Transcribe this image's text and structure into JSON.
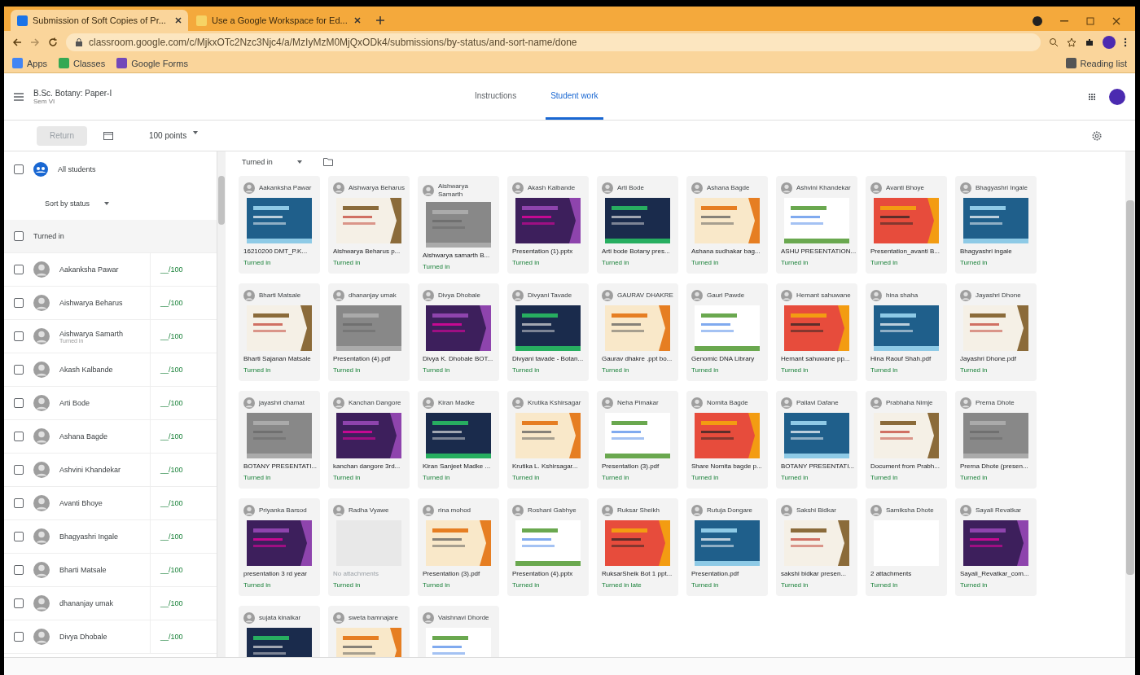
{
  "browser": {
    "tabs": [
      {
        "title": "Submission of Soft Copies of Pr...",
        "selected": true
      },
      {
        "title": "Use a Google Workspace for Ed...",
        "selected": false
      }
    ],
    "url": "classroom.google.com/c/MjkxOTc2Nzc3Njc4/a/MzIyMzM0MjQxODk4/submissions/by-status/and-sort-name/done",
    "bookmarks": [
      "Apps",
      "Classes",
      "Google Forms"
    ],
    "reading_list": "Reading list"
  },
  "header": {
    "class_name": "B.Sc. Botany: Paper-I",
    "section": "Sem VI",
    "tabs": [
      {
        "label": "Instructions",
        "selected": false
      },
      {
        "label": "Student work",
        "selected": true
      }
    ]
  },
  "toolbar": {
    "return_button": {
      "label": "Return",
      "disabled": true
    },
    "points": "100 points"
  },
  "sidebar": {
    "all_students": {
      "label": "All students",
      "checked": false
    },
    "sort": "Sort by status",
    "section": {
      "label": "Turned in",
      "checked": false
    },
    "students": [
      {
        "name": "Aakanksha Pawar",
        "grade": "__/100",
        "checked": false
      },
      {
        "name": "Aishwarya Beharus",
        "grade": "__/100",
        "checked": false
      },
      {
        "name": "Aishwarya Samarth",
        "note": "Turned in",
        "grade": "__/100",
        "checked": false
      },
      {
        "name": "Akash Kalbande",
        "grade": "__/100",
        "checked": false
      },
      {
        "name": "Arti Bode",
        "grade": "__/100",
        "checked": false
      },
      {
        "name": "Ashana Bagde",
        "grade": "__/100",
        "checked": false
      },
      {
        "name": "Ashvini Khandekar",
        "grade": "__/100",
        "checked": false
      },
      {
        "name": "Avanti Bhoye",
        "grade": "__/100",
        "checked": false
      },
      {
        "name": "Bhagyashri Ingale",
        "grade": "__/100",
        "checked": false
      },
      {
        "name": "Bharti Matsale",
        "grade": "__/100",
        "checked": false
      },
      {
        "name": "dhananjay umak",
        "grade": "__/100",
        "checked": false
      },
      {
        "name": "Divya Dhobale",
        "grade": "__/100",
        "checked": false
      }
    ]
  },
  "work": {
    "filter": "Turned in",
    "cards": [
      {
        "name": "Aakanksha Pawar",
        "file": "16210200 DMT_P.K...",
        "status": "Turned in",
        "kind": "picture"
      },
      {
        "name": "Aishwarya Beharus",
        "file": "Aishwarya Beharus p...",
        "status": "Turned in",
        "kind": "picture"
      },
      {
        "name": "Aishwarya Samarth",
        "file": "Aishwarya samarth B...",
        "status": "Turned in",
        "kind": "picture"
      },
      {
        "name": "Akash Kalbande",
        "file": "Presentation (1).pptx",
        "status": "Turned in",
        "kind": "picture"
      },
      {
        "name": "Arti Bode",
        "file": "Arti bode Botany pres...",
        "status": "Turned in",
        "kind": "picture"
      },
      {
        "name": "Ashana Bagde",
        "file": "Ashana sudhakar bag...",
        "status": "Turned in",
        "kind": "picture"
      },
      {
        "name": "Ashvini Khandekar",
        "file": "ASHU PRESENTATION...",
        "status": "Turned in",
        "kind": "picture"
      },
      {
        "name": "Avanti Bhoye",
        "file": "Presentation_avanti B...",
        "status": "Turned in",
        "kind": "picture"
      },
      {
        "name": "Bhagyashri Ingale",
        "file": "Bhagyashri ingale",
        "status": "Turned in",
        "kind": "picture"
      },
      {
        "name": "Bharti Matsale",
        "file": "Bharti Sajanan Matsale",
        "status": "Turned in",
        "kind": "picture"
      },
      {
        "name": "dhananjay umak",
        "file": "Presentation (4).pdf",
        "status": "Turned in",
        "kind": "picture"
      },
      {
        "name": "Divya Dhobale",
        "file": "Divya K. Dhobale BOT...",
        "status": "Turned in",
        "kind": "picture"
      },
      {
        "name": "Divyani Tavade",
        "file": "Divyani tavade - Botan...",
        "status": "Turned in",
        "kind": "picture"
      },
      {
        "name": "GAURAV DHAKRE",
        "file": "Gaurav dhakre .ppt bo...",
        "status": "Turned in",
        "kind": "picture"
      },
      {
        "name": "Gauri Pawde",
        "file": "Genomic DNA Library",
        "status": "Turned in",
        "kind": "picture"
      },
      {
        "name": "Hemant sahuwane",
        "file": "Hemant sahuwane pp...",
        "status": "Turned in",
        "kind": "picture"
      },
      {
        "name": "hina shaha",
        "file": "Hina Raouf Shah.pdf",
        "status": "Turned in",
        "kind": "picture"
      },
      {
        "name": "Jayashri Dhone",
        "file": "Jayashri Dhone.pdf",
        "status": "Turned in",
        "kind": "picture"
      },
      {
        "name": "jayashri chamat",
        "file": "BOTANY PRESENTATI...",
        "status": "Turned in",
        "kind": "picture"
      },
      {
        "name": "Kanchan Dangore",
        "file": "kanchan dangore 3rd...",
        "status": "Turned in",
        "kind": "picture"
      },
      {
        "name": "Kiran Madke",
        "file": "Kiran Sanjeet Madke ...",
        "status": "Turned in",
        "kind": "picture"
      },
      {
        "name": "Krutika Kshirsagar",
        "file": "Krutika L. Kshirsagar...",
        "status": "Turned in",
        "kind": "picture"
      },
      {
        "name": "Neha Pimakar",
        "file": "Presentation (3).pdf",
        "status": "Turned in",
        "kind": "picture"
      },
      {
        "name": "Nomita Bagde",
        "file": "Share Nomita bagde p...",
        "status": "Turned in",
        "kind": "picture"
      },
      {
        "name": "Pallavi Dafane",
        "file": "BOTANY PRESENTATI...",
        "status": "Turned in",
        "kind": "picture"
      },
      {
        "name": "Prabhaha Nimje",
        "file": "Document from Prabh...",
        "status": "Turned in",
        "kind": "picture"
      },
      {
        "name": "Prerna Dhote",
        "file": "Prerna Dhote (presen...",
        "status": "Turned in",
        "kind": "picture"
      },
      {
        "name": "Priyanka Barsod",
        "file": "presentation 3 rd year",
        "status": "Turned in",
        "kind": "picture"
      },
      {
        "name": "Radha Vyawe",
        "file": "No attachments",
        "status": "Turned in",
        "kind": "empty"
      },
      {
        "name": "rina mohod",
        "file": "Presentation (3).pdf",
        "status": "Turned in",
        "kind": "picture"
      },
      {
        "name": "Roshani Gabhye",
        "file": "Presentation (4).pptx",
        "status": "Turned in",
        "kind": "picture"
      },
      {
        "name": "Ruksar Sheikh",
        "file": "RuksarSheik Bot 1 ppt...",
        "status": "Turned in late",
        "kind": "picture"
      },
      {
        "name": "Rutuja Dongare",
        "file": "Presentation.pdf",
        "status": "Turned in",
        "kind": "picture"
      },
      {
        "name": "Sakshi Bidkar",
        "file": "sakshi bidkar presen...",
        "status": "Turned in",
        "kind": "picture"
      },
      {
        "name": "Samiksha Dhote",
        "file": "2 attachments",
        "status": "Turned in",
        "kind": "blank"
      },
      {
        "name": "Sayali Revatkar",
        "file": "Sayali_Revatkar_com...",
        "status": "Turned in",
        "kind": "picture"
      },
      {
        "name": "sujata kinalkar",
        "kind": "picture"
      },
      {
        "name": "sweta bamnajare",
        "kind": "picture"
      },
      {
        "name": "Vaishnavi Dhorde",
        "kind": "picture"
      }
    ]
  }
}
